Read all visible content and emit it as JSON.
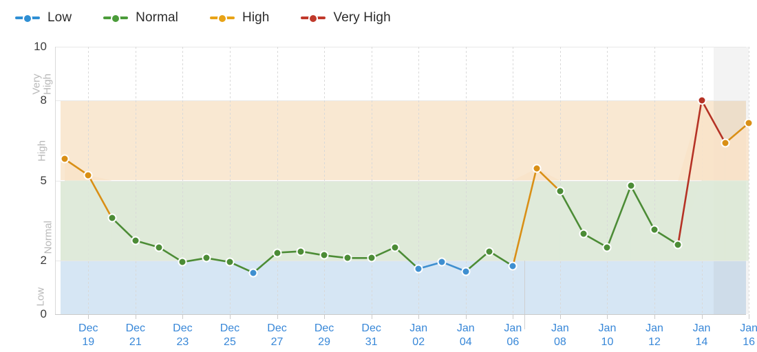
{
  "legend": {
    "items": [
      {
        "label": "Low",
        "color": "#2f8fd4"
      },
      {
        "label": "Normal",
        "color": "#4b9c3a"
      },
      {
        "label": "High",
        "color": "#e8a317"
      },
      {
        "label": "Very High",
        "color": "#c0392b"
      }
    ]
  },
  "colors": {
    "low_band": "#d6e6f4",
    "normal_band": "#dfead9",
    "high_band": "#f9e8d2",
    "very_high_band": "#ffffff",
    "low_line": "#3f8fd0",
    "normal_line": "#4c8c36",
    "high_line": "#d98f16",
    "very_high_line": "#b53225",
    "low_fill": "#d6e6f4",
    "normal_fill": "#dfead9",
    "high_fill": "#f9e3c9",
    "gridline": "#e8e8e8",
    "axis_label": "#3787d8",
    "forecast_shade": "rgba(140,140,140,0.10)"
  },
  "axes": {
    "y_ticks": [
      "0",
      "2",
      "5",
      "8",
      "10"
    ],
    "y_tick_values": [
      0,
      2,
      5,
      8,
      10
    ],
    "y_band_labels": [
      "Low",
      "Normal",
      "High",
      "Very\nHigh"
    ],
    "y_min": 0,
    "y_max": 10,
    "x_labels": [
      "Dec\n19",
      "Dec\n21",
      "Dec\n23",
      "Dec\n25",
      "Dec\n27",
      "Dec\n29",
      "Dec\n31",
      "Jan\n02",
      "Jan\n04",
      "Jan\n06",
      "Jan\n08",
      "Jan\n10",
      "Jan\n12",
      "Jan\n14",
      "Jan\n16"
    ]
  },
  "chart_data": {
    "type": "line",
    "title": "",
    "xlabel": "",
    "ylabel": "",
    "ylim": [
      0,
      10
    ],
    "grid": true,
    "legend_position": "top-left",
    "bands": [
      {
        "name": "Low",
        "from": 0,
        "to": 2,
        "color": "#d6e6f4"
      },
      {
        "name": "Normal",
        "from": 2,
        "to": 5,
        "color": "#dfead9"
      },
      {
        "name": "High",
        "from": 5,
        "to": 8,
        "color": "#f9e8d2"
      },
      {
        "name": "Very High",
        "from": 8,
        "to": 10,
        "color": "#ffffff"
      }
    ],
    "forecast_region": {
      "start_date": "Jan 15",
      "end_date": "Jan 16"
    },
    "divider_after": "Jan 06",
    "x": [
      "Dec 18",
      "Dec 19",
      "Dec 20",
      "Dec 21",
      "Dec 22",
      "Dec 23",
      "Dec 24",
      "Dec 25",
      "Dec 26",
      "Dec 27",
      "Dec 28",
      "Dec 29",
      "Dec 30",
      "Dec 31",
      "Jan 01",
      "Jan 02",
      "Jan 03",
      "Jan 04",
      "Jan 05",
      "Jan 06",
      "Jan 07",
      "Jan 08",
      "Jan 09",
      "Jan 10",
      "Jan 11",
      "Jan 12",
      "Jan 13",
      "Jan 14",
      "Jan 15",
      "Jan 16"
    ],
    "values": [
      5.8,
      5.2,
      3.6,
      2.75,
      2.5,
      1.95,
      2.1,
      1.95,
      1.55,
      2.3,
      2.35,
      2.2,
      2.1,
      2.1,
      2.5,
      1.7,
      1.95,
      1.6,
      2.35,
      1.8,
      5.45,
      4.6,
      3.0,
      2.5,
      4.8,
      3.15,
      2.6,
      8.0,
      6.4,
      7.15
    ],
    "categories": [
      "High",
      "High",
      "Normal",
      "Normal",
      "Normal",
      "Normal",
      "Normal",
      "Normal",
      "Low",
      "Normal",
      "Normal",
      "Normal",
      "Normal",
      "Normal",
      "Normal",
      "Low",
      "Low",
      "Low",
      "Normal",
      "Low",
      "High",
      "Normal",
      "Normal",
      "Normal",
      "Normal",
      "Normal",
      "Normal",
      "Very High",
      "High",
      "High"
    ]
  }
}
